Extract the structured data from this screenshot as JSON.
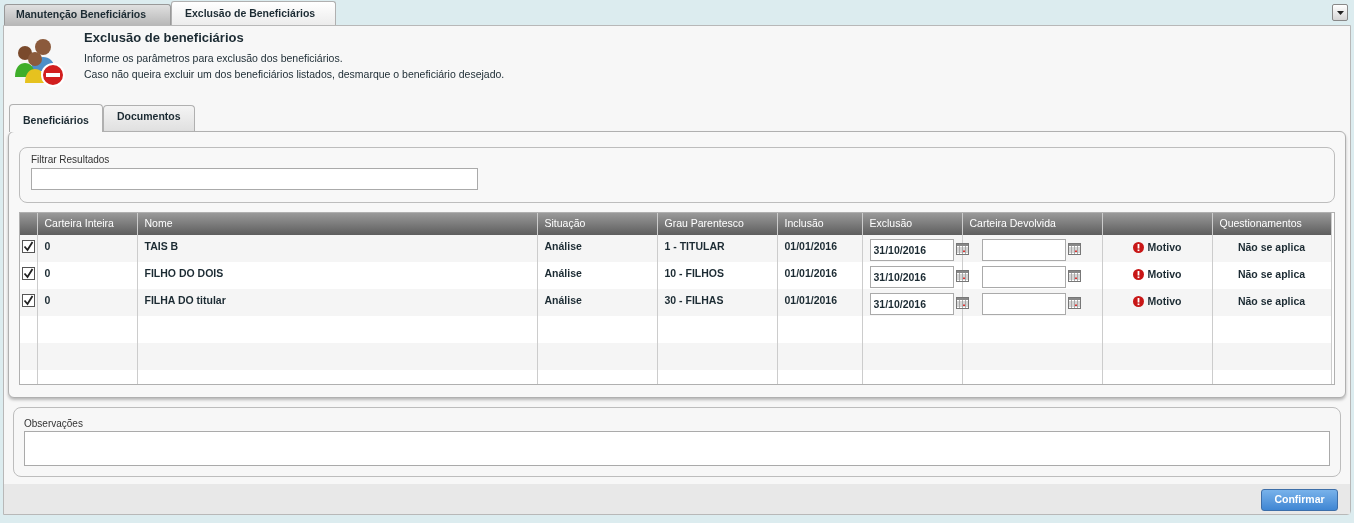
{
  "top_tabs": [
    {
      "label": "Manutenção Beneficiários",
      "selected": false
    },
    {
      "label": "Exclusão de Beneficiários",
      "selected": true
    }
  ],
  "header": {
    "title": "Exclusão de beneficiários",
    "lines": [
      "Informe os parâmetros para exclusão dos beneficiários.",
      "Caso não queira excluir um dos beneficiários listados, desmarque o beneficiário desejado."
    ]
  },
  "inner_tabs": [
    {
      "label": "Beneficiários",
      "selected": true
    },
    {
      "label": "Documentos",
      "selected": false
    }
  ],
  "filter": {
    "label": "Filtrar Resultados"
  },
  "table": {
    "columns": [
      "",
      "Carteira Inteira",
      "Nome",
      "Situação",
      "Grau Parentesco",
      "Inclusão",
      "Exclusão",
      "Carteira Devolvida",
      "",
      "Questionamentos"
    ],
    "rows": [
      {
        "checked": true,
        "carteira": "0",
        "nome": "TAIS B",
        "situacao": "Análise",
        "grau": "1 - TITULAR",
        "inclusao": "01/01/2016",
        "exclusao": "31/10/2016",
        "motivo": "Motivo",
        "questionamentos": "Não se aplica"
      },
      {
        "checked": true,
        "carteira": "0",
        "nome": "FILHO DO DOIS",
        "situacao": "Análise",
        "grau": "10 - FILHOS",
        "inclusao": "01/01/2016",
        "exclusao": "31/10/2016",
        "motivo": "Motivo",
        "questionamentos": "Não se aplica"
      },
      {
        "checked": true,
        "carteira": "0",
        "nome": "FILHA DO titular",
        "situacao": "Análise",
        "grau": "30 - FILHAS",
        "inclusao": "01/01/2016",
        "exclusao": "31/10/2016",
        "motivo": "Motivo",
        "questionamentos": "Não se aplica"
      }
    ]
  },
  "observacoes": {
    "label": "Observações"
  },
  "confirm_button": "Confirmar"
}
